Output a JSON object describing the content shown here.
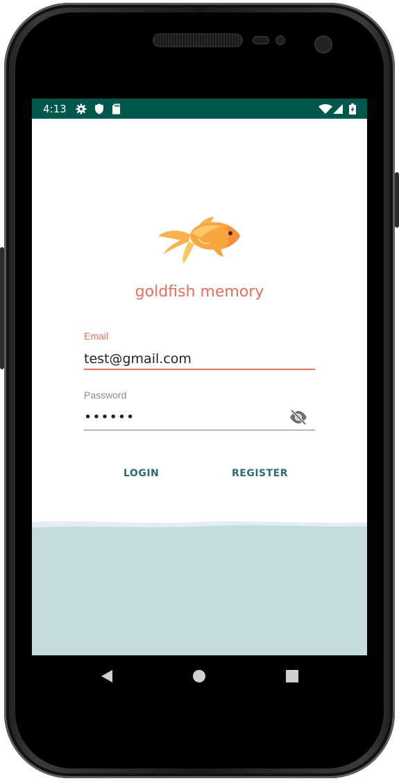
{
  "status_bar": {
    "time": "4:13",
    "icons": [
      "gear-icon",
      "shield-icon",
      "sd-card-icon",
      "wifi-icon",
      "signal-icon",
      "battery-charging-icon"
    ],
    "background": "#00574b"
  },
  "app": {
    "logo": "goldfish-logo",
    "title": "goldfish memory",
    "accent_color": "#e66f5b",
    "button_color": "#2b6c72",
    "water_color": "#c3dcde"
  },
  "form": {
    "email_label": "Email",
    "email_value": "test@gmail.com",
    "password_label": "Password",
    "password_value": "••••••",
    "password_toggle_icon": "eye-off-icon"
  },
  "actions": {
    "login_label": "LOGIN",
    "register_label": "REGISTER"
  },
  "nav_bar": {
    "buttons": [
      "back-icon",
      "home-icon",
      "recents-icon"
    ]
  }
}
